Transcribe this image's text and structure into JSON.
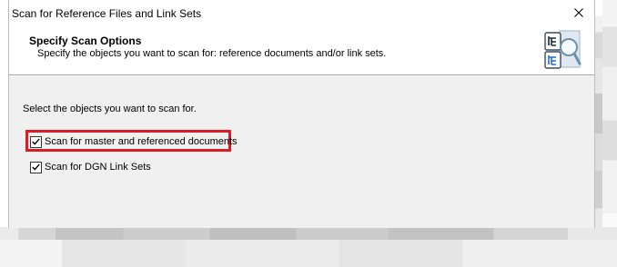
{
  "window": {
    "title": "Scan for Reference Files and Link Sets"
  },
  "header": {
    "title": "Specify Scan Options",
    "subtitle": "Specify the objects you want to scan for: reference documents and/or link sets.",
    "icon": "scan-tree-magnifier-icon"
  },
  "body": {
    "instruction": "Select the objects you want to scan for.",
    "options": [
      {
        "label": "Scan for master and referenced documents",
        "checked": true,
        "highlighted": true
      },
      {
        "label": "Scan for DGN Link Sets",
        "checked": true,
        "highlighted": false
      }
    ]
  },
  "colors": {
    "highlight": "#e01b24",
    "panel_bg": "#f0f0f0"
  }
}
